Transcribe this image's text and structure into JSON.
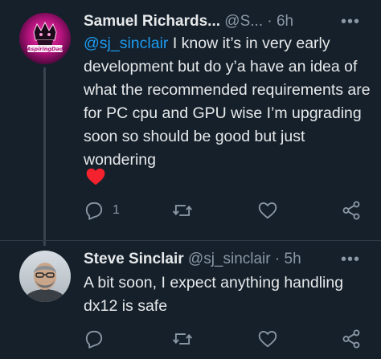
{
  "colors": {
    "background": "#15202b",
    "text": "#e7e9ea",
    "muted": "#8b98a5",
    "link": "#1d9bf0",
    "heart": "#f4212e"
  },
  "tweets": [
    {
      "author_name": "Samuel Richards...",
      "handle": "@S...",
      "separator": "·",
      "time": "6h",
      "avatar_icon": "gaming-logo-avatar",
      "avatar_text": "AspiringDad",
      "mention": "@sj_sinclair",
      "text": " I know it’s in very early development but do y’a have an idea of what the recommended requirements are for PC cpu and GPU wise I’m upgrading soon so should be good but just wondering",
      "emoji": "red-heart-emoji",
      "reply_count": "1",
      "retweet_count": "",
      "like_count": ""
    },
    {
      "author_name": "Steve Sinclair",
      "handle": "@sj_sinclair",
      "separator": "·",
      "time": "5h",
      "avatar_icon": "profile-photo-avatar",
      "mention": "",
      "text": "A bit soon, I expect anything handling dx12 is safe",
      "reply_count": "",
      "retweet_count": "",
      "like_count": ""
    }
  ],
  "icons": {
    "more": "more-dots-icon",
    "reply": "reply-icon",
    "retweet": "retweet-icon",
    "like": "like-heart-icon",
    "share": "share-icon"
  }
}
